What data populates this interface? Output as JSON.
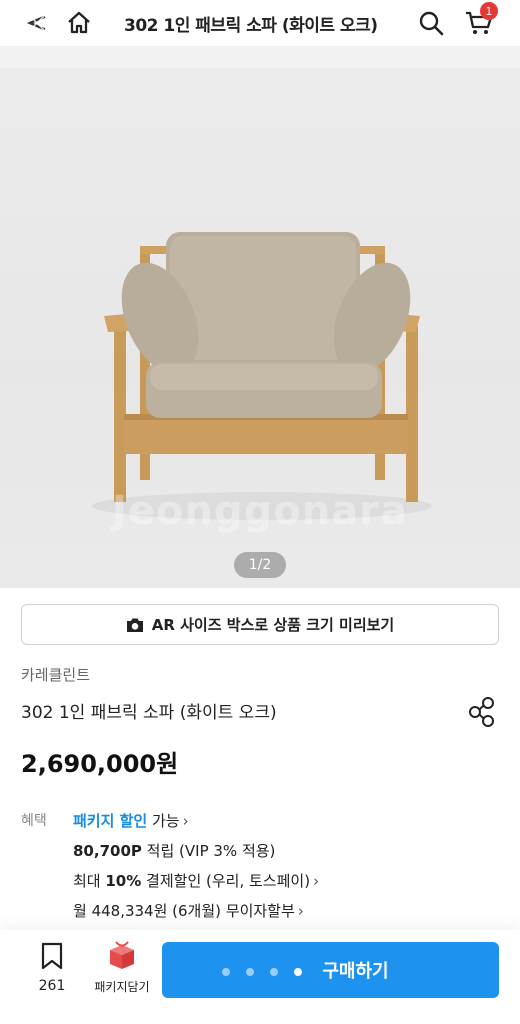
{
  "header": {
    "title": "302 1인 패브릭 소파 (화이트 오크)",
    "cart_count": "1",
    "icons": [
      "back-arrow-icon",
      "home-icon",
      "search-icon",
      "cart-icon"
    ]
  },
  "gallery": {
    "pager": "1/2",
    "watermark": "Jeonggonara"
  },
  "ar_button": {
    "label": "AR 사이즈 박스로 상품 크기 미리보기",
    "icon": "camera-icon"
  },
  "product": {
    "brand": "카레클린트",
    "name": "302 1인 패브릭 소파 (화이트 오크)",
    "price": "2,690,000원"
  },
  "benefits": {
    "label": "혜택",
    "line1_highlight": "패키지 할인",
    "line1_rest": " 가능",
    "line2_bold": "80,700P",
    "line2_rest": " 적립 (VIP 3% 적용)",
    "line3_prefix": "최대 ",
    "line3_bold": "10%",
    "line3_rest": " 결제할인 (우리, 토스페이)",
    "line4": "월 448,334원 (6개월) 무이자할부"
  },
  "bottom_bar": {
    "bookmark_count": "261",
    "package_label": "패키지담기",
    "buy_label": "구매하기"
  },
  "colors": {
    "accent": "#1d93ef",
    "highlight": "#1a8be0",
    "badge": "#e53935"
  }
}
